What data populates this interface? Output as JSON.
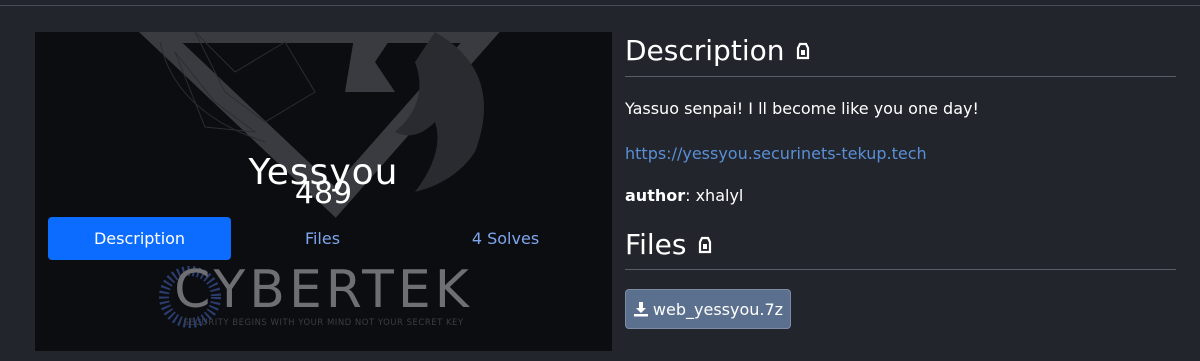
{
  "challenge": {
    "name": "Yessyou",
    "points": "489",
    "brand_text": "CYBERTEK",
    "brand_tagline": "SECURITY BEGINS WITH YOUR MIND NOT YOUR SECRET KEY"
  },
  "tabs": [
    {
      "label": "Description",
      "active": true
    },
    {
      "label": "Files",
      "active": false
    },
    {
      "label": "4 Solves",
      "active": false
    }
  ],
  "description": {
    "title": "Description",
    "text": "Yassuo senpai! I ll become like you one day!",
    "link": "https://yessyou.securinets-tekup.tech",
    "author_label": "author",
    "author_value": ": xhalyl"
  },
  "files": {
    "title": "Files",
    "items": [
      {
        "name": "web_yessyou.7z",
        "icon": "download-icon"
      }
    ]
  },
  "colors": {
    "background": "#22252c",
    "active_tab": "#0b6cff",
    "tab_link": "#7ea6ee",
    "link": "#5a8fd6",
    "file_button": "#5b708e"
  }
}
